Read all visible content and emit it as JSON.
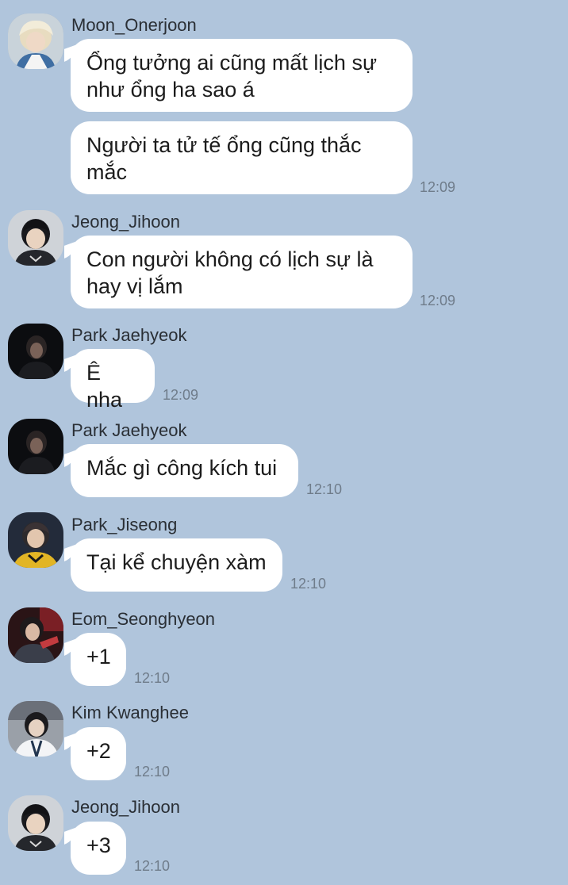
{
  "chat": {
    "messages": [
      {
        "sender": "Moon_Onerjoon",
        "avatar": "avatar-blond-hair",
        "bubbles": [
          "Ổng tưởng ai cũng mất lịch sự\nnhư ổng ha sao á",
          "Người ta tử tế ổng cũng thắc\nmắc"
        ],
        "time": "12:09"
      },
      {
        "sender": "Jeong_Jihoon",
        "avatar": "avatar-dark-hair-jersey",
        "bubbles": [
          "Con người không có lịch sự là\nhay vị lắm"
        ],
        "time": "12:09"
      },
      {
        "sender": "Park Jaehyeok",
        "avatar": "avatar-dark-silhouette",
        "bubbles": [
          "Ê nha"
        ],
        "time": "12:09"
      },
      {
        "sender": "Park Jaehyeok",
        "avatar": "avatar-dark-silhouette",
        "bubbles": [
          "Mắc gì công kích tui"
        ],
        "time": "12:10"
      },
      {
        "sender": "Park_Jiseong",
        "avatar": "avatar-yellow-jersey",
        "bubbles": [
          "Tại kể chuyện xàm"
        ],
        "time": "12:10"
      },
      {
        "sender": "Eom_Seonghyeon",
        "avatar": "avatar-red-stage",
        "bubbles": [
          "+1"
        ],
        "time": "12:10"
      },
      {
        "sender": "Kim Kwanghee",
        "avatar": "avatar-white-jacket",
        "bubbles": [
          "+2"
        ],
        "time": "12:10"
      },
      {
        "sender": "Jeong_Jihoon",
        "avatar": "avatar-dark-hair-jersey",
        "bubbles": [
          "+3"
        ],
        "time": "12:10"
      }
    ]
  },
  "colors": {
    "background": "#b0c5dc",
    "bubble": "#ffffff",
    "sender_text": "#2a2f35",
    "time_text": "#6f7c8a"
  }
}
